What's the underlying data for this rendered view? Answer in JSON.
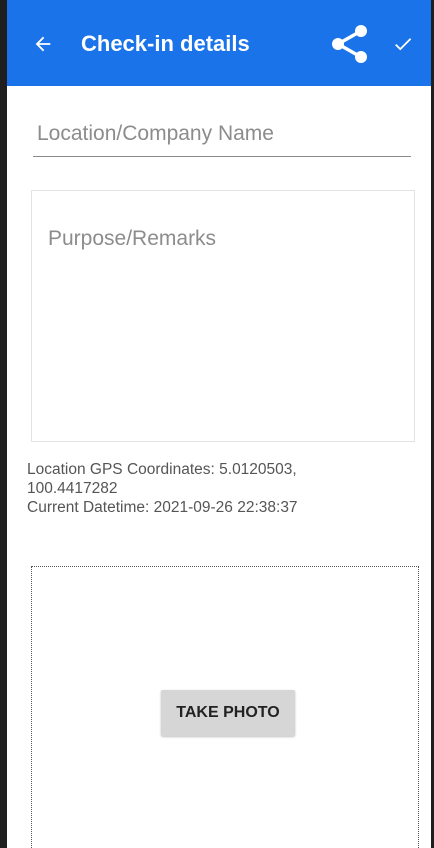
{
  "appbar": {
    "title": "Check-in details",
    "background": "#1a73e8",
    "back_icon": "arrow-left-icon",
    "share_icon": "share-icon",
    "confirm_icon": "checkmark-icon"
  },
  "form": {
    "location_placeholder": "Location/Company Name",
    "remarks_placeholder": "Purpose/Remarks"
  },
  "info": {
    "gps_line1": "Location GPS Coordinates: 5.0120503,",
    "gps_line2": "100.4417282",
    "datetime": "Current Datetime: 2021-09-26 22:38:37"
  },
  "photo": {
    "button_label": "TAKE PHOTO"
  }
}
